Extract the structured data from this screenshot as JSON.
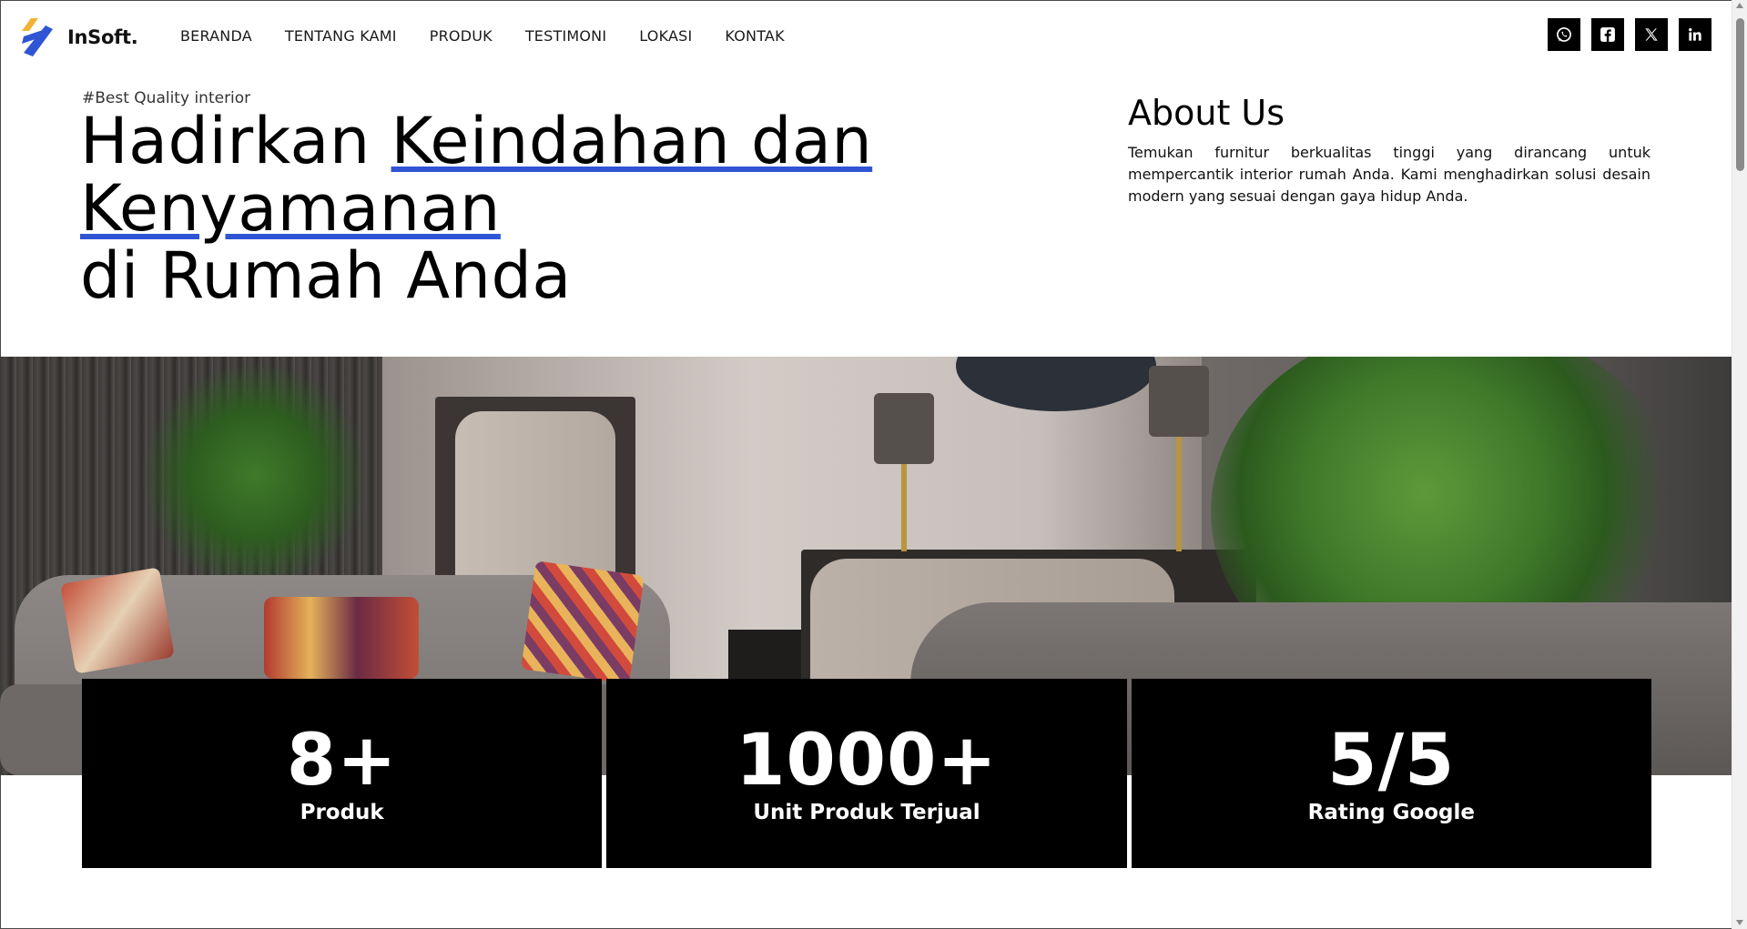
{
  "brand": {
    "name": "InSoft.",
    "logo_colors": {
      "primary": "#2f55d4",
      "accent": "#f2b233"
    }
  },
  "nav": {
    "items": [
      {
        "label": "BERANDA"
      },
      {
        "label": "TENTANG KAMI"
      },
      {
        "label": "PRODUK"
      },
      {
        "label": "TESTIMONI"
      },
      {
        "label": "LOKASI"
      },
      {
        "label": "KONTAK"
      }
    ]
  },
  "social": [
    {
      "name": "whatsapp-icon"
    },
    {
      "name": "facebook-icon"
    },
    {
      "name": "x-icon"
    },
    {
      "name": "linkedin-icon"
    }
  ],
  "hero": {
    "tagline": "#Best Quality interior",
    "headline": {
      "part1": "Hadirkan ",
      "highlight1": "Keindahan dan",
      "highlight2": "Kenyamanan",
      "part2": "di Rumah Anda"
    },
    "highlight_color": "#2f55d4"
  },
  "about": {
    "title": "About Us",
    "text": "Temukan furnitur berkualitas tinggi yang dirancang untuk mempercantik interior rumah Anda. Kami menghadirkan solusi desain modern yang sesuai dengan gaya hidup Anda."
  },
  "stats": [
    {
      "value": "8+",
      "label": "Produk"
    },
    {
      "value": "1000+",
      "label": "Unit Produk Terjual"
    },
    {
      "value": "5/5",
      "label": "Rating Google"
    }
  ]
}
